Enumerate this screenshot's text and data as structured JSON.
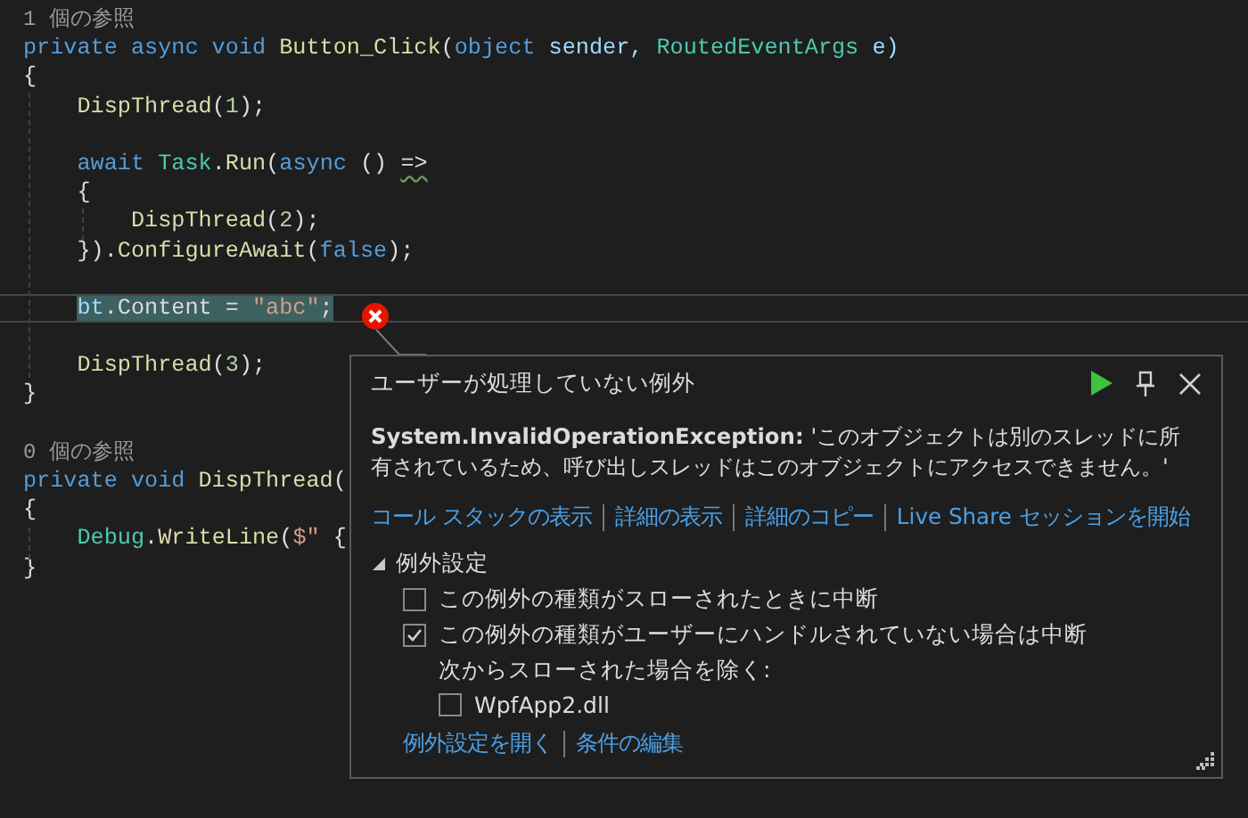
{
  "code_lines": [
    {
      "kind": "codelens",
      "tokens": [
        {
          "text": "1 個の参照",
          "kind": "lens"
        }
      ]
    },
    {
      "kind": "code",
      "tokens": [
        {
          "text": "private async void ",
          "kind": "keyword"
        },
        {
          "text": "Button_Click",
          "kind": "method"
        },
        {
          "text": "(",
          "kind": "plain"
        },
        {
          "text": "object",
          "kind": "keyword"
        },
        {
          "text": " sender, ",
          "kind": "param"
        },
        {
          "text": "RoutedEventArgs",
          "kind": "type"
        },
        {
          "text": " e)",
          "kind": "param"
        }
      ]
    },
    {
      "kind": "code",
      "tokens": [
        {
          "text": "{",
          "kind": "plain"
        }
      ]
    },
    {
      "kind": "code",
      "tokens": [
        {
          "text": "    DispThread",
          "kind": "method"
        },
        {
          "text": "(",
          "kind": "plain"
        },
        {
          "text": "1",
          "kind": "number"
        },
        {
          "text": ");",
          "kind": "plain"
        }
      ]
    },
    {
      "kind": "blank"
    },
    {
      "kind": "code",
      "tokens": [
        {
          "text": "    await ",
          "kind": "keyword"
        },
        {
          "text": "Task",
          "kind": "type"
        },
        {
          "text": ".",
          "kind": "plain"
        },
        {
          "text": "Run",
          "kind": "method"
        },
        {
          "text": "(",
          "kind": "plain"
        },
        {
          "text": "async",
          "kind": "keyword"
        },
        {
          "text": " () ",
          "kind": "plain"
        },
        {
          "text": "=>",
          "kind": "plain",
          "warning": true
        }
      ]
    },
    {
      "kind": "code",
      "tokens": [
        {
          "text": "    {",
          "kind": "plain"
        }
      ]
    },
    {
      "kind": "code",
      "tokens": [
        {
          "text": "        DispThread",
          "kind": "method"
        },
        {
          "text": "(",
          "kind": "plain"
        },
        {
          "text": "2",
          "kind": "number"
        },
        {
          "text": ");",
          "kind": "plain"
        }
      ]
    },
    {
      "kind": "code",
      "tokens": [
        {
          "text": "    }).",
          "kind": "plain"
        },
        {
          "text": "ConfigureAwait",
          "kind": "method"
        },
        {
          "text": "(",
          "kind": "plain"
        },
        {
          "text": "false",
          "kind": "keyword"
        },
        {
          "text": ");",
          "kind": "plain"
        }
      ]
    },
    {
      "kind": "blank"
    },
    {
      "kind": "code",
      "current": true,
      "tokens": [
        {
          "text": "    bt",
          "kind": "param",
          "highlighted": true
        },
        {
          "text": ".Content = ",
          "kind": "plain",
          "highlighted": true
        },
        {
          "text": "\"abc\"",
          "kind": "string",
          "highlighted": true
        },
        {
          "text": ";",
          "kind": "plain",
          "highlighted": true
        }
      ]
    },
    {
      "kind": "blank"
    },
    {
      "kind": "code",
      "tokens": [
        {
          "text": "    DispThread",
          "kind": "method"
        },
        {
          "text": "(",
          "kind": "plain"
        },
        {
          "text": "3",
          "kind": "number"
        },
        {
          "text": ");",
          "kind": "plain"
        }
      ]
    },
    {
      "kind": "code",
      "tokens": [
        {
          "text": "}",
          "kind": "plain"
        }
      ]
    },
    {
      "kind": "blank"
    },
    {
      "kind": "codelens",
      "tokens": [
        {
          "text": "0 個の参照",
          "kind": "lens"
        }
      ]
    },
    {
      "kind": "code",
      "tokens": [
        {
          "text": "private void ",
          "kind": "keyword"
        },
        {
          "text": "DispThread",
          "kind": "method"
        },
        {
          "text": "(",
          "kind": "plain"
        }
      ]
    },
    {
      "kind": "code",
      "tokens": [
        {
          "text": "{",
          "kind": "plain"
        }
      ]
    },
    {
      "kind": "code",
      "tokens": [
        {
          "text": "    Debug",
          "kind": "type"
        },
        {
          "text": ".",
          "kind": "plain"
        },
        {
          "text": "WriteLine",
          "kind": "method"
        },
        {
          "text": "(",
          "kind": "plain"
        },
        {
          "text": "$\"",
          "kind": "string"
        },
        {
          "text": " {",
          "kind": "plain"
        }
      ]
    },
    {
      "kind": "code",
      "tokens": [
        {
          "text": "}",
          "kind": "plain"
        }
      ]
    }
  ],
  "exception_popup": {
    "title": "ユーザーが処理していない例外",
    "message": "**System.InvalidOperationException:** 'このオブジェクトは別のスレッドに所有されているため、呼び出しスレッドはこのオブジェクトにアクセスできません。'",
    "links": [
      "コール スタックの表示",
      "詳細の表示",
      "詳細のコピー",
      "Live Share セッションを開始"
    ],
    "settings": {
      "header": "例外設定",
      "expanded": true,
      "options": [
        {
          "label": "この例外の種類がスローされたときに中断",
          "checked": false
        },
        {
          "label": "この例外の種類がユーザーにハンドルされていない場合は中断",
          "checked": true
        }
      ],
      "exclusion_label": "次からスローされた場合を除く:",
      "exclusions": [
        {
          "label": "WpfApp2.dll",
          "checked": false
        }
      ],
      "links": [
        "例外設定を開く",
        "条件の編集"
      ]
    }
  }
}
